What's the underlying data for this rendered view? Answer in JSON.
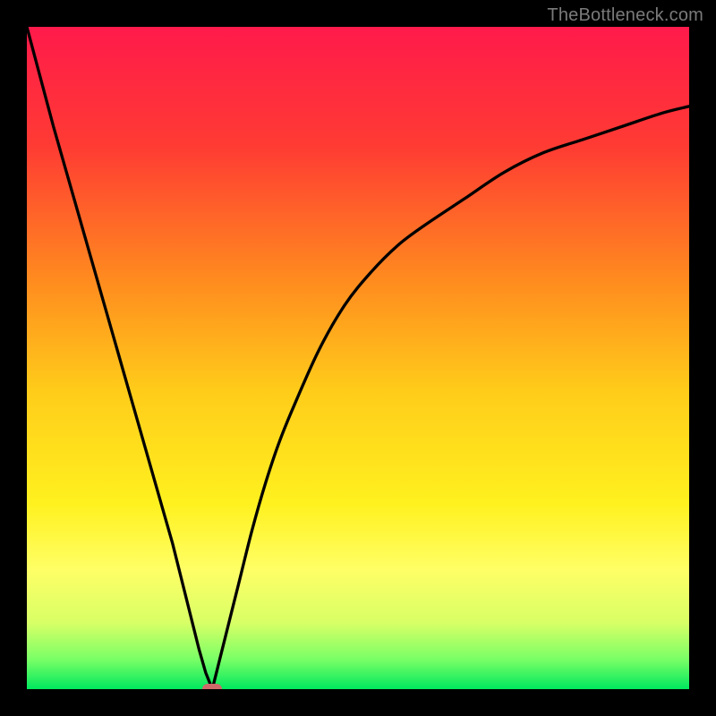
{
  "watermark": "TheBottleneck.com",
  "chart_data": {
    "type": "line",
    "title": "",
    "xlabel": "",
    "ylabel": "",
    "xlim": [
      0,
      100
    ],
    "ylim": [
      0,
      100
    ],
    "gradient_stops": [
      {
        "offset": 0,
        "color": "#ff1a4b"
      },
      {
        "offset": 0.18,
        "color": "#ff3b33"
      },
      {
        "offset": 0.38,
        "color": "#ff8a1f"
      },
      {
        "offset": 0.55,
        "color": "#ffcc1a"
      },
      {
        "offset": 0.72,
        "color": "#fff11f"
      },
      {
        "offset": 0.82,
        "color": "#ffff66"
      },
      {
        "offset": 0.9,
        "color": "#d8ff66"
      },
      {
        "offset": 0.955,
        "color": "#7aff66"
      },
      {
        "offset": 1.0,
        "color": "#00e85e"
      }
    ],
    "series": [
      {
        "name": "left-branch",
        "x": [
          0,
          2,
          4,
          6,
          8,
          10,
          12,
          14,
          16,
          18,
          20,
          22,
          24,
          25,
          26,
          27,
          28
        ],
        "values": [
          100,
          92.5,
          85,
          78,
          71,
          64,
          57,
          50,
          43,
          36,
          29,
          22,
          14,
          10,
          6,
          2.5,
          0
        ]
      },
      {
        "name": "right-branch",
        "x": [
          28,
          29,
          30,
          32,
          34,
          36,
          38,
          40,
          44,
          48,
          52,
          56,
          60,
          66,
          72,
          78,
          84,
          90,
          96,
          100
        ],
        "values": [
          0,
          4,
          8,
          16,
          24,
          31,
          37,
          42,
          51,
          58,
          63,
          67,
          70,
          74,
          78,
          81,
          83,
          85,
          87,
          88
        ]
      }
    ],
    "marker": {
      "x": 28,
      "y": 0,
      "color": "#cf6a6a"
    }
  }
}
